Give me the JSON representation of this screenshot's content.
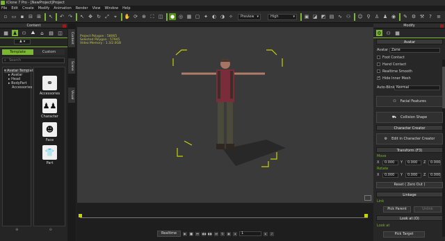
{
  "app": {
    "title": "iClone 7 Pro - [NewProject]Project"
  },
  "menu": [
    "File",
    "Edit",
    "Create",
    "Modify",
    "Animation",
    "Render",
    "View",
    "Window",
    "Help"
  ],
  "toolbar": {
    "preview_label": "Preview",
    "quality_label": "High"
  },
  "content_panel": {
    "title": "Content",
    "tab_template": "Template",
    "tab_custom": "Custom",
    "search_placeholder": "Search",
    "tree": [
      "Avatar Template",
      "Avatar",
      "Head",
      "BodyPart",
      "Accessories"
    ],
    "gallery": [
      {
        "label": "Accessories",
        "icon": "glasses-icon"
      },
      {
        "label": "Character",
        "icon": "people-icon"
      },
      {
        "label": "Face",
        "icon": "face-icon"
      },
      {
        "label": "Part",
        "icon": "shirt-icon"
      }
    ]
  },
  "side_tabs": [
    "Content",
    "Scene",
    "Visual"
  ],
  "viewport": {
    "stats": [
      "Project Polygon : 58065",
      "Selected Polygon : 57945",
      "Video Memory : 1.3/2.0GB"
    ]
  },
  "timeline": {
    "realtime_label": "Realtime",
    "frame_value": "1"
  },
  "modify_panel": {
    "title": "Modify",
    "avatar_header": "Avatar",
    "avatar_label": "Avatar",
    "avatar_value": "Zane",
    "checks": [
      {
        "label": "Foot Contact",
        "checked": false
      },
      {
        "label": "Hand Contact",
        "checked": false
      },
      {
        "label": "Realtime Smooth",
        "checked": false
      },
      {
        "label": "Hide Inner Mesh",
        "checked": true
      }
    ],
    "autoblink_label": "Auto-Blink",
    "autoblink_value": "Normal",
    "facial_features_label": "Facial Features",
    "collision_shape_label": "Collision Shape",
    "character_creator_header": "Character Creator",
    "edit_cc_label": "Edit in Character Creator",
    "transform_header": "Transform (F3)",
    "move_label": "Move",
    "rotate_label": "Rotate",
    "move": {
      "x": "0.000",
      "y": "0.000",
      "z": "0.000"
    },
    "rotate": {
      "x": "0.000",
      "y": "0.000",
      "z": "0.000"
    },
    "reset_label": "Reset ( Zero Out )",
    "linkage_header": "Linkage",
    "link_label": "Link",
    "pick_parent_label": "Pick Parent",
    "unlink_label": "Unlink",
    "lookat_header": "Look at (O)",
    "lookat_label": "Look at",
    "pick_target_label": "Pick Target"
  }
}
